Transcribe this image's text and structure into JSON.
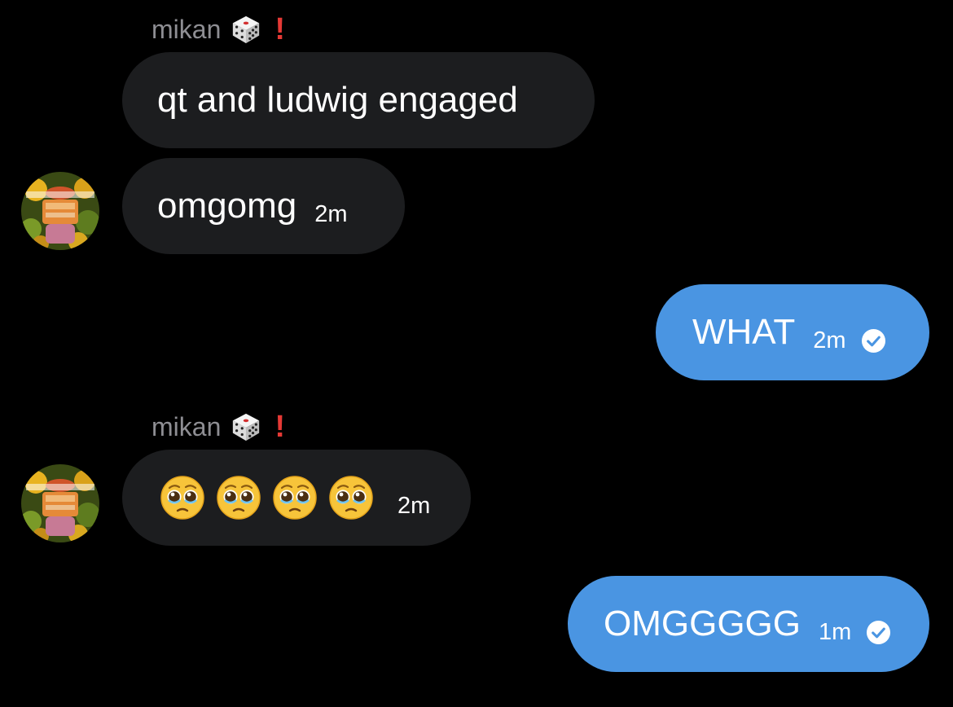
{
  "thread": {
    "groups": [
      {
        "sender": {
          "name": "mikan",
          "badge_icon": "dice-icon",
          "alert_icon": "exclamation-icon",
          "avatar_icon": "orange-avatar"
        },
        "messages": [
          {
            "text": "qt and ludwig engaged",
            "time": ""
          },
          {
            "text": "omgomg",
            "time": "2m"
          }
        ]
      },
      {
        "outgoing": {
          "text": "WHAT",
          "time": "2m",
          "status_icon": "read-check-icon"
        }
      },
      {
        "sender": {
          "name": "mikan",
          "badge_icon": "dice-icon",
          "alert_icon": "exclamation-icon",
          "avatar_icon": "orange-avatar"
        },
        "messages": [
          {
            "emojis": [
              "pleading-face-emoji",
              "pleading-face-emoji",
              "pleading-face-emoji",
              "pleading-face-emoji"
            ],
            "time": "2m"
          }
        ]
      },
      {
        "outgoing": {
          "text": "OMGGGGG",
          "time": "1m",
          "status_icon": "read-check-icon"
        }
      }
    ]
  },
  "colors": {
    "background": "#000000",
    "incoming_bubble": "#1c1d1f",
    "outgoing_bubble": "#4a95e2",
    "sender_name": "#8e8e93",
    "alert": "#e53935",
    "text": "#ffffff"
  }
}
